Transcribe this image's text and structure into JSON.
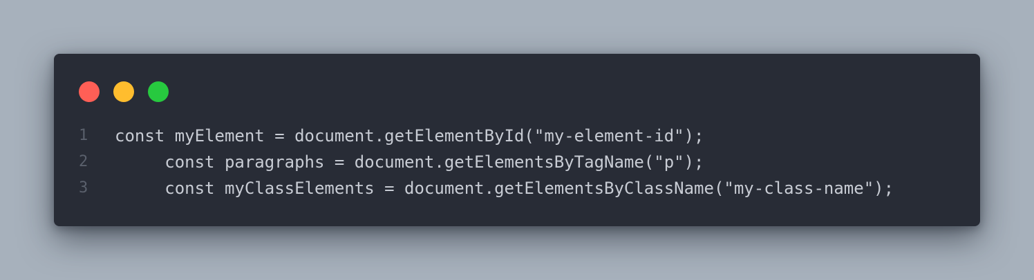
{
  "window": {
    "controls": [
      {
        "name": "close",
        "color": "#ff5f56"
      },
      {
        "name": "minimize",
        "color": "#ffbd2e"
      },
      {
        "name": "maximize",
        "color": "#27c93f"
      }
    ]
  },
  "code": {
    "lines": [
      {
        "number": "1",
        "text": "const myElement = document.getElementById(\"my-element-id\");"
      },
      {
        "number": "2",
        "text": "     const paragraphs = document.getElementsByTagName(\"p\");"
      },
      {
        "number": "3",
        "text": "     const myClassElements = document.getElementsByClassName(\"my-class-name\");"
      }
    ]
  },
  "colors": {
    "background": "#a7b1bc",
    "window": "#282c36",
    "code_text": "#c8ccd4",
    "line_number": "#5a606c"
  }
}
